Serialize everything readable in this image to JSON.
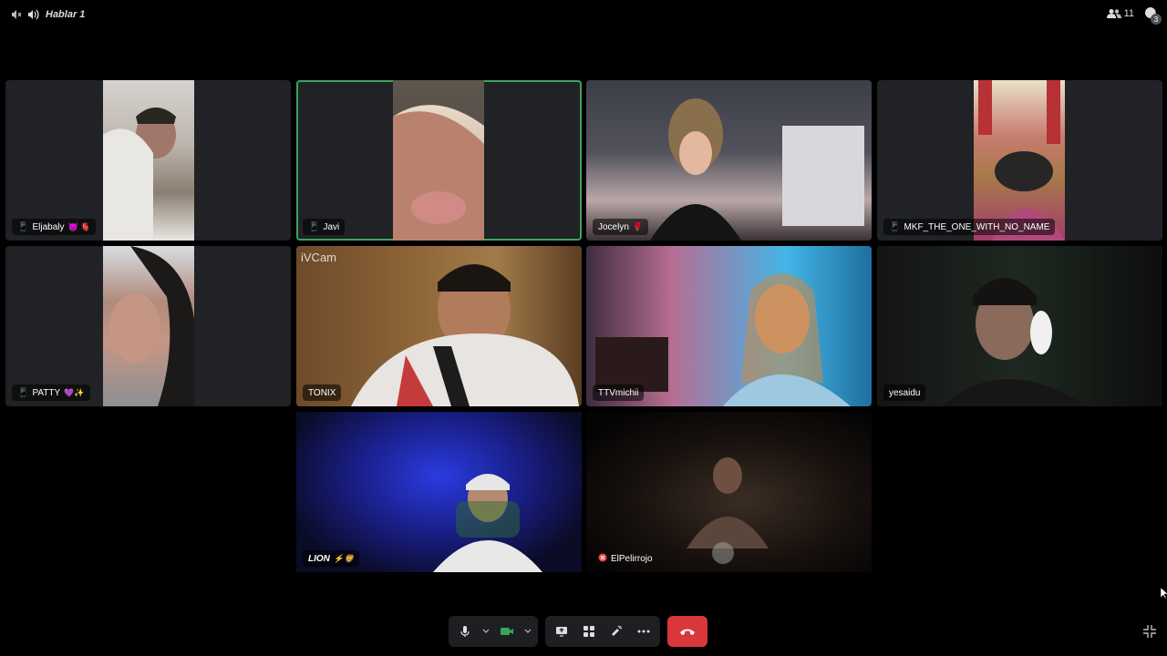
{
  "channel": {
    "label": "Hablar 1",
    "icons": [
      "speaker-muted-icon",
      "speaker-icon"
    ]
  },
  "header": {
    "participant_count": "11",
    "activity_badge": "3"
  },
  "participants": [
    {
      "name": "Eljabaly",
      "emoji": "👿 🫀",
      "icon": "phone-icon"
    },
    {
      "name": "Javi",
      "emoji": "",
      "icon": "phone-icon"
    },
    {
      "name": "Jocelyn",
      "emoji": "🌹",
      "icon": ""
    },
    {
      "name": "MKF_THE_ONE_WITH_NO_NAME",
      "emoji": "",
      "icon": "phone-icon"
    },
    {
      "name": "PATTY",
      "emoji": "💜✨",
      "icon": "phone-icon"
    },
    {
      "name": "TONIX",
      "emoji": "",
      "icon": "",
      "watermark": "iVCam"
    },
    {
      "name": "TTVmichii",
      "emoji": "",
      "icon": ""
    },
    {
      "name": "yesaidu",
      "emoji": "",
      "icon": ""
    },
    {
      "name": "LION",
      "emoji": "⚡🦁",
      "icon": ""
    },
    {
      "name": "ElPelirrojo",
      "emoji": "",
      "icon": "muted-icon"
    }
  ],
  "controls": {
    "buttons": [
      "microphone-icon",
      "camera-icon",
      "screen-share-icon",
      "activities-icon",
      "soundboard-icon",
      "more-icon",
      "hang-up-icon"
    ]
  },
  "colors": {
    "speaking": "#3ba55d",
    "hangup": "#da373c",
    "tile": "#202225"
  }
}
